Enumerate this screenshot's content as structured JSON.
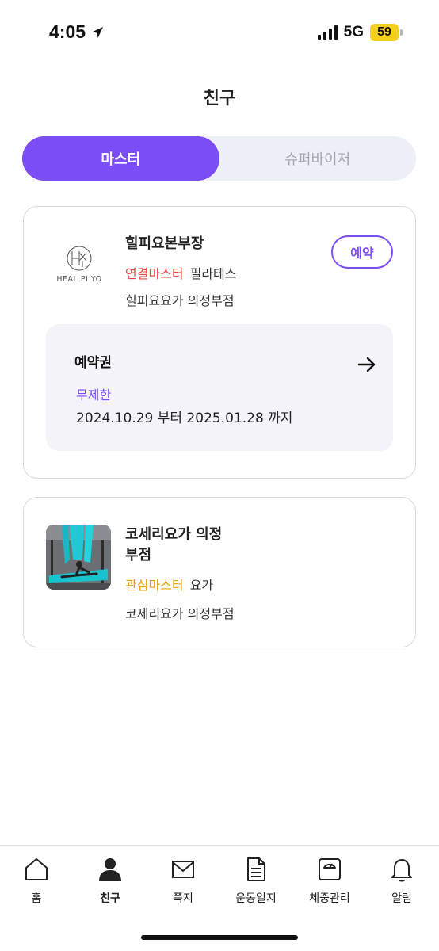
{
  "status_bar": {
    "time": "4:05",
    "network": "5G",
    "battery": "59"
  },
  "header": {
    "title": "친구"
  },
  "tabs": [
    {
      "label": "마스터",
      "active": true
    },
    {
      "label": "슈퍼바이저",
      "active": false
    }
  ],
  "cards": [
    {
      "logo_text": "HEAL PI YO",
      "name": "힐피요본부장",
      "tag": "연결마스터",
      "category": "필라테스",
      "location": "힐피요요가 의정부점",
      "reserve_label": "예약",
      "pass": {
        "title": "예약권",
        "type": "무제한",
        "period": "2024.10.29 부터 2025.01.28 까지"
      }
    },
    {
      "name_line1": "코세리요가 의정",
      "name_line2": "부점",
      "tag": "관심마스터",
      "category": "요가",
      "location": "코세리요가 의정부점"
    }
  ],
  "bottom_nav": [
    {
      "label": "홈",
      "icon": "home-icon",
      "active": false
    },
    {
      "label": "친구",
      "icon": "person-icon",
      "active": true
    },
    {
      "label": "쪽지",
      "icon": "mail-icon",
      "active": false
    },
    {
      "label": "운동일지",
      "icon": "document-icon",
      "active": false
    },
    {
      "label": "체중관리",
      "icon": "scale-icon",
      "active": false
    },
    {
      "label": "알림",
      "icon": "bell-icon",
      "active": false
    }
  ],
  "colors": {
    "accent": "#7b4df5",
    "tag_red": "#ee4444",
    "tag_yellow": "#e8a20a",
    "battery": "#f4d01c"
  }
}
